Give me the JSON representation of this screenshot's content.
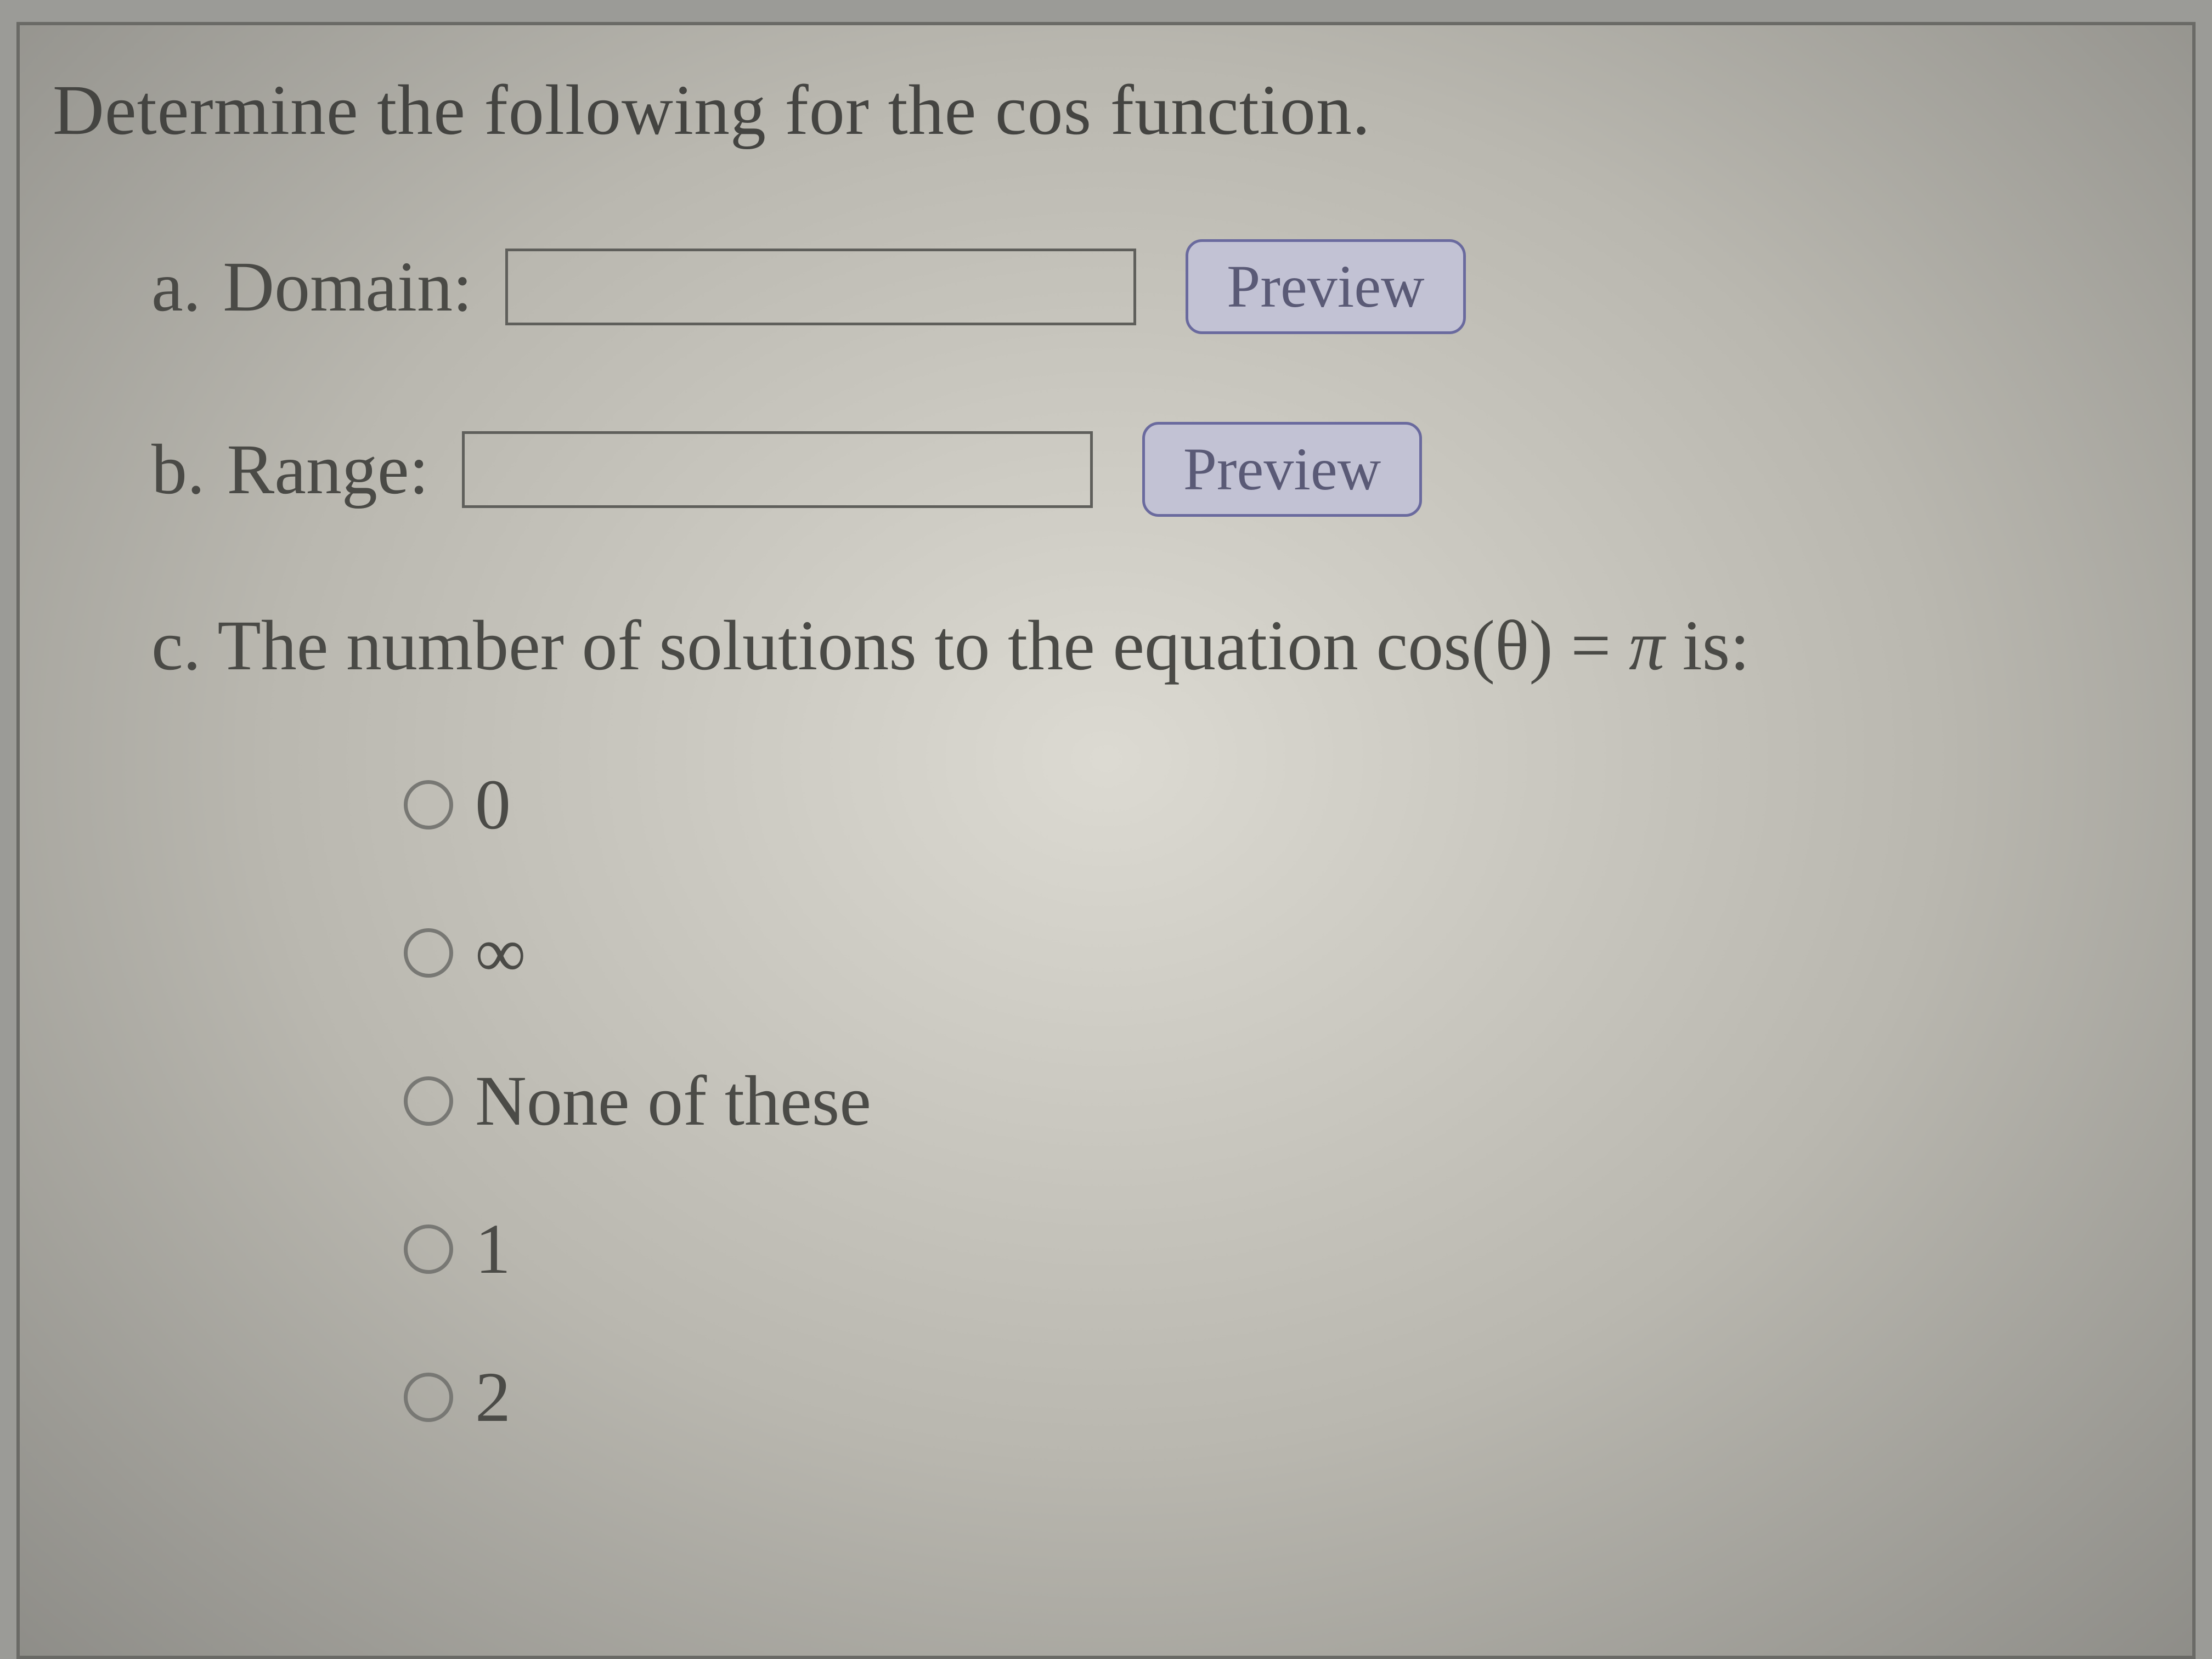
{
  "prompt": "Determine the following for the cos function.",
  "parts": {
    "a": {
      "letter": "a.",
      "label": "Domain:",
      "value": "",
      "preview": "Preview"
    },
    "b": {
      "letter": "b.",
      "label": "Range:",
      "value": "",
      "preview": "Preview"
    },
    "c": {
      "letter": "c.",
      "text_before": "The number of solutions to the equation ",
      "equation_lhs": "cos(θ)",
      "equation_eq": " = ",
      "equation_rhs": "π",
      "text_after": " is:"
    }
  },
  "options": [
    {
      "label": "0"
    },
    {
      "label": "∞"
    },
    {
      "label": "None of these"
    },
    {
      "label": "1"
    },
    {
      "label": "2"
    }
  ]
}
